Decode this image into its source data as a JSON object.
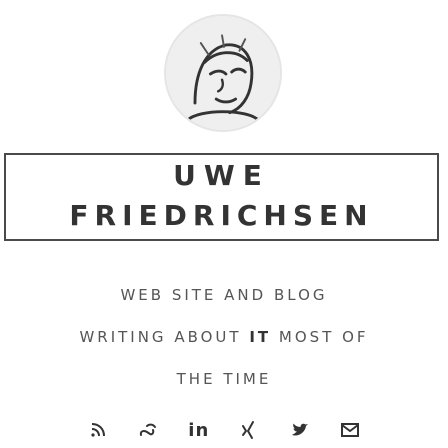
{
  "name": {
    "first": "UWE",
    "last": "FRIEDRICHSEN"
  },
  "tagline": {
    "line1": "WEB SITE AND BLOG",
    "line2_before": "WRITING ABOUT ",
    "line2_emphasis": "IT",
    "line2_after": " MOST OF",
    "line3": "THE TIME"
  },
  "socials": {
    "items": [
      {
        "icon": "rss-icon"
      },
      {
        "icon": "speakerdeck-icon"
      },
      {
        "icon": "linkedin-icon",
        "label": "in"
      },
      {
        "icon": "xing-icon"
      },
      {
        "icon": "twitter-icon"
      },
      {
        "icon": "email-icon"
      }
    ]
  }
}
